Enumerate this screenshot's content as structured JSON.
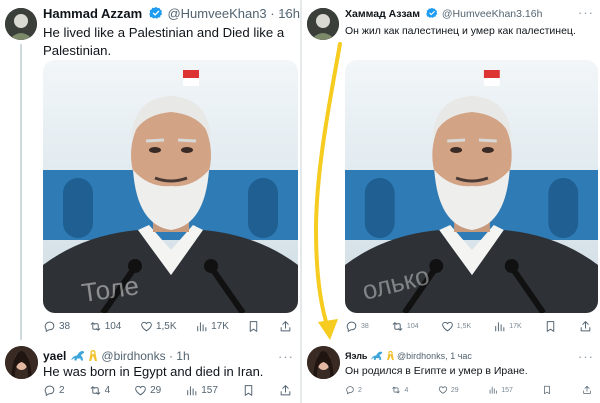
{
  "original": {
    "author_name": "Hammad Azzam",
    "handle": "@HumveeKhan3",
    "time": "16h",
    "separator": " · ",
    "text": "He lived like a Palestinian and Died like a Palestinian.",
    "media_watermark": "Толе",
    "actions": {
      "replies": "38",
      "reposts": "104",
      "likes": "1,5K",
      "views": "17K"
    },
    "reply": {
      "author_name": "yael",
      "handle": "@birdhonks",
      "time": "1h",
      "text": "He was born in Egypt and died in Iran.",
      "actions": {
        "replies": "2",
        "reposts": "4",
        "likes": "29",
        "views": "157"
      }
    }
  },
  "translated": {
    "author_name": "Хаммад Аззам",
    "handle": "@HumveeKhan3.16h",
    "text": "Он жил как палестинец и умер как палестинец.",
    "media_watermark": "олько",
    "actions": {
      "replies": "38",
      "reposts": "104",
      "likes": "1,5K",
      "views": "17K"
    },
    "reply": {
      "author_name": "Яэль",
      "handle": "@birdhonks",
      "time": "1 час",
      "separator": ", ",
      "text": "Он родился в Египте и умер в Иране.",
      "actions": {
        "replies": "2",
        "reposts": "4",
        "likes": "29",
        "views": "157"
      }
    }
  },
  "colors": {
    "verified": "#1d9bf0",
    "arrow": "#f5cc1f",
    "ribbon": "#f2c230",
    "text_primary": "#0f1419",
    "text_secondary": "#536471"
  },
  "icons": [
    "reply-icon",
    "repost-icon",
    "like-icon",
    "views-icon",
    "bookmark-icon",
    "share-icon",
    "verified-badge-icon",
    "dinosaur-emoji-icon",
    "yellow-ribbon-emoji-icon",
    "more-icon"
  ]
}
